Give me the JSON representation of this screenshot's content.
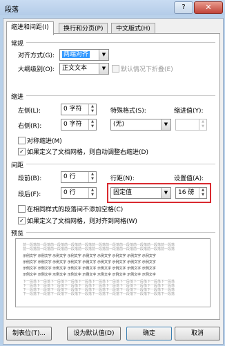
{
  "window": {
    "title": "段落",
    "help": "?",
    "close": "✕"
  },
  "tabs": [
    "缩进和间距(I)",
    "换行和分页(P)",
    "中文版式(H)"
  ],
  "general": {
    "heading": "常规",
    "align_label": "对齐方式(G):",
    "align_value": "两端对齐",
    "outline_label": "大纲级别(O):",
    "outline_value": "正文文本",
    "collapse_label": "默认情况下折叠(E)"
  },
  "indent": {
    "heading": "缩进",
    "left_label": "左侧(L):",
    "left_value": "0 字符",
    "right_label": "右侧(R):",
    "right_value": "0 字符",
    "special_label": "特殊格式(S):",
    "special_value": "(无)",
    "indent_by_label": "缩进值(Y):",
    "indent_by_value": "",
    "mirror_label": "对称缩进(M)",
    "auto_adjust_label": "如果定义了文档网格，则自动调整右缩进(D)"
  },
  "spacing": {
    "heading": "间距",
    "before_label": "段前(B):",
    "before_value": "0 行",
    "after_label": "段后(F):",
    "after_value": "0 行",
    "line_spacing_label": "行距(N):",
    "line_spacing_value": "固定值",
    "at_label": "设置值(A):",
    "at_value": "16 磅",
    "no_space_label": "在相同样式的段落间不添加空格(C)",
    "snap_grid_label": "如果定义了文档网格，则对齐到网格(W)"
  },
  "preview": {
    "heading": "预览",
    "prev_line": "前一段落前一段落前一段落前一段落前一段落前一段落前一段落前一段落前一段落前一段落前一段落",
    "sample_line": "示例文字 示例文字 示例文字 示例文字 示例文字 示例文字 示例文字 示例文字 示例文字",
    "next_line": "下一段落下一段落下一段落下一段落下一段落下一段落下一段落下一段落下一段落下一段落下一段落"
  },
  "buttons": {
    "tabs": "制表位(T)...",
    "set_default": "设为默认值(D)",
    "ok": "确定",
    "cancel": "取消"
  },
  "colors": {
    "highlight": "#d9292f",
    "selection": "#3399ff"
  }
}
